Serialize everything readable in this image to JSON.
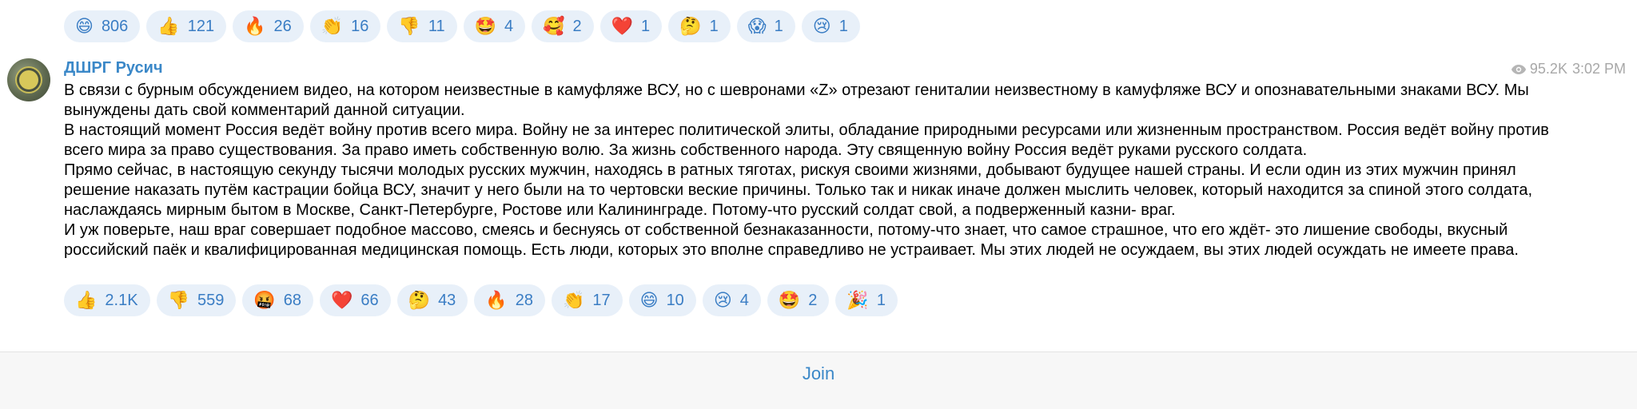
{
  "top_reactions": [
    {
      "emoji": "😄",
      "icon": "grinning-face-icon",
      "count": "806"
    },
    {
      "emoji": "👍",
      "icon": "thumbs-up-icon",
      "count": "121"
    },
    {
      "emoji": "🔥",
      "icon": "fire-icon",
      "count": "26"
    },
    {
      "emoji": "👏",
      "icon": "clapping-hands-icon",
      "count": "16"
    },
    {
      "emoji": "👎",
      "icon": "thumbs-down-icon",
      "count": "11"
    },
    {
      "emoji": "🤩",
      "icon": "star-struck-icon",
      "count": "4"
    },
    {
      "emoji": "🥰",
      "icon": "smiling-hearts-icon",
      "count": "2"
    },
    {
      "emoji": "❤️",
      "icon": "red-heart-icon",
      "count": "1"
    },
    {
      "emoji": "🤔",
      "icon": "thinking-face-icon",
      "count": "1"
    },
    {
      "emoji": "😱",
      "icon": "screaming-face-icon",
      "count": "1"
    },
    {
      "emoji": "😢",
      "icon": "crying-face-icon",
      "count": "1"
    }
  ],
  "post": {
    "author": "ДШРГ Русич",
    "views": "95.2K",
    "time": "3:02 PM",
    "paragraphs": [
      "В связи с бурным обсуждением видео, на котором неизвестные в камуфляже ВСУ, но с шевронами «Z» отрезают гениталии неизвестному в камуфляже ВСУ и опознавательными знаками ВСУ. Мы вынуждены дать свой комментарий данной ситуации.",
      "В настоящий момент Россия ведёт войну против всего мира. Войну не за интерес политической элиты, обладание природными ресурсами или жизненным пространством. Россия ведёт войну против всего мира за право существования. За право иметь собственную волю. За жизнь собственного народа. Эту священную войну Россия ведёт руками русского солдата.",
      "Прямо сейчас, в настоящую секунду тысячи молодых русских мужчин, находясь в ратных тяготах, рискуя своими жизнями, добывают будущее нашей страны. И если один из этих мужчин принял решение наказать путём кастрации бойца ВСУ, значит у него были на то чертовски веские причины. Только так и никак иначе должен мыслить человек, который находится за спиной этого солдата, наслаждаясь мирным бытом в Москве, Санкт-Петербурге, Ростове или Калининграде. Потому-что русский солдат свой, а подверженный казни- враг.",
      "И уж поверьте, наш враг совершает подобное массово, смеясь и беснуясь от собственной безнаказанности, потому-что знает, что самое страшное, что его ждёт- это лишение свободы, вкусный российский паёк и квалифицированная медицинская помощь. Есть люди, которых это вполне справедливо не устраивает. Мы этих людей не осуждаем, вы этих людей осуждать не имеете права."
    ],
    "reactions": [
      {
        "emoji": "👍",
        "icon": "thumbs-up-icon",
        "count": "2.1K"
      },
      {
        "emoji": "👎",
        "icon": "thumbs-down-icon",
        "count": "559"
      },
      {
        "emoji": "🤬",
        "icon": "cursing-face-icon",
        "count": "68"
      },
      {
        "emoji": "❤️",
        "icon": "red-heart-icon",
        "count": "66"
      },
      {
        "emoji": "🤔",
        "icon": "thinking-face-icon",
        "count": "43"
      },
      {
        "emoji": "🔥",
        "icon": "fire-icon",
        "count": "28"
      },
      {
        "emoji": "👏",
        "icon": "clapping-hands-icon",
        "count": "17"
      },
      {
        "emoji": "😄",
        "icon": "grinning-face-icon",
        "count": "10"
      },
      {
        "emoji": "😢",
        "icon": "crying-face-icon",
        "count": "4"
      },
      {
        "emoji": "🤩",
        "icon": "star-struck-icon",
        "count": "2"
      },
      {
        "emoji": "🎉",
        "icon": "party-popper-icon",
        "count": "1"
      }
    ]
  },
  "join_label": "Join",
  "colors": {
    "accent": "#3b88c8",
    "chip_bg": "#e8f0f9",
    "chip_text": "#3a7dc4",
    "meta_text": "#a8a8a8",
    "footer_bg": "#f7f7f7"
  }
}
